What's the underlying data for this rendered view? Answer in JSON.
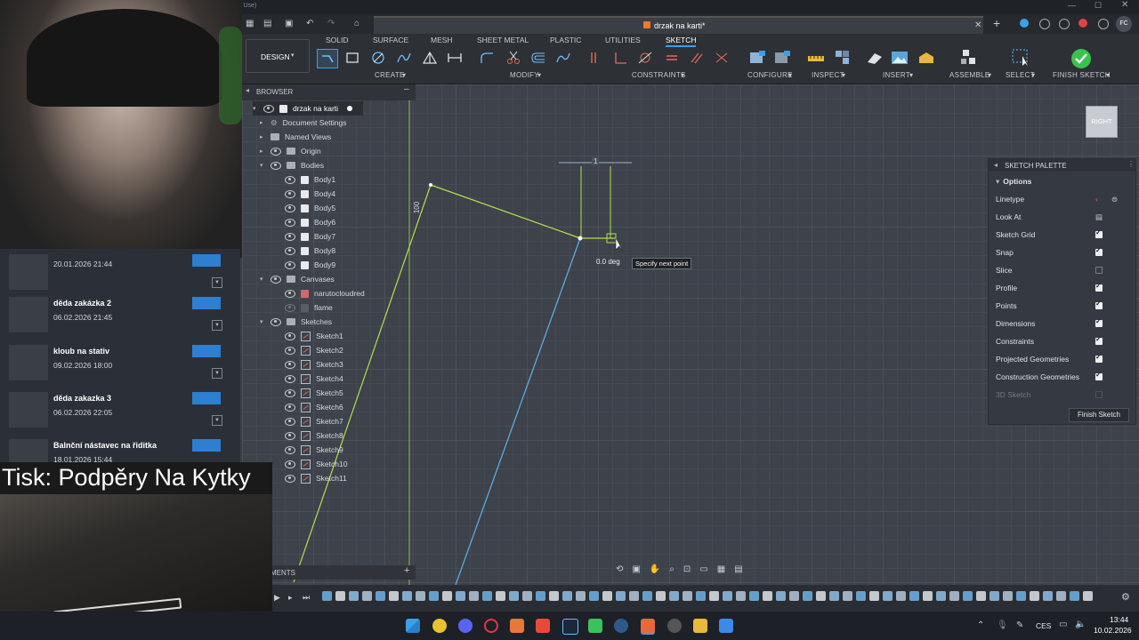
{
  "window": {
    "title": "drzak na karti*",
    "user_initials": "FC",
    "corner_title": "l Use)"
  },
  "ribbon": {
    "workspace": "DESIGN",
    "tabs": [
      "SOLID",
      "SURFACE",
      "MESH",
      "SHEET METAL",
      "PLASTIC",
      "UTILITIES",
      "SKETCH"
    ],
    "active_tab": "SKETCH",
    "groups": [
      "CREATE",
      "MODIFY",
      "CONSTRAINTS",
      "CONFIGURE",
      "INSPECT",
      "INSERT",
      "ASSEMBLE",
      "SELECT",
      "FINISH SKETCH"
    ]
  },
  "browser": {
    "title": "BROWSER",
    "root": "drzak na karti",
    "items": [
      "Document Settings",
      "Named Views",
      "Origin",
      "Bodies",
      "Body1",
      "Body4",
      "Body5",
      "Body6",
      "Body7",
      "Body8",
      "Body9",
      "Canvases",
      "narutocloudred",
      "flame",
      "Sketches",
      "Sketch1",
      "Sketch2",
      "Sketch3",
      "Sketch4",
      "Sketch5",
      "Sketch6",
      "Sketch7",
      "Sketch8",
      "Sketch9",
      "Sketch10",
      "Sketch11"
    ]
  },
  "projects": [
    {
      "name": "",
      "date": "20.01.2026 21:44"
    },
    {
      "name": "děda zakázka 2",
      "date": "06.02.2026 21:45"
    },
    {
      "name": "kloub na stativ",
      "date": "09.02.2026 18:00"
    },
    {
      "name": "děda zakazka 3",
      "date": "06.02.2026 22:05"
    },
    {
      "name": "Balnční nástavec na řiditka",
      "date": "18.01.2026 15:44"
    }
  ],
  "overlay_caption": "Tisk: Podpěry Na Kytky",
  "comments_label": "MENTS",
  "canvas": {
    "dimension_100": "100",
    "dimension_top": "1",
    "angle": "0.0 deg",
    "tooltip": "Specify next point",
    "viewcube": "RIGHT"
  },
  "palette": {
    "title": "SKETCH PALETTE",
    "section": "Options",
    "rows": [
      {
        "label": "Linetype",
        "state": "icon"
      },
      {
        "label": "Look At",
        "state": "icon"
      },
      {
        "label": "Sketch Grid",
        "state": "on"
      },
      {
        "label": "Snap",
        "state": "on"
      },
      {
        "label": "Slice",
        "state": "off"
      },
      {
        "label": "Profile",
        "state": "on"
      },
      {
        "label": "Points",
        "state": "on"
      },
      {
        "label": "Dimensions",
        "state": "on"
      },
      {
        "label": "Constraints",
        "state": "on"
      },
      {
        "label": "Projected Geometries",
        "state": "on"
      },
      {
        "label": "Construction Geometries",
        "state": "on"
      },
      {
        "label": "3D Sketch",
        "state": "disabled"
      }
    ],
    "finish_button": "Finish Sketch"
  },
  "taskbar": {
    "lang": "CES",
    "time": "13:44",
    "date": "10.02.2026"
  },
  "colors": {
    "accent": "#3aa0e8",
    "sketch_line": "#b5e04a",
    "construction": "#5fb4e8",
    "finish_green": "#39c24f"
  }
}
